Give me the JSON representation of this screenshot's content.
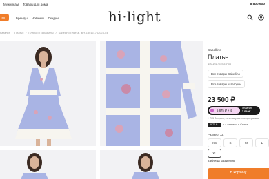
{
  "topbar": {
    "nav": [
      "Мужчинам",
      "Товары для дома"
    ],
    "phone": "8 800 600"
  },
  "logo": "hi·light",
  "header": {
    "catalog_label": "лог",
    "nav": [
      "Бренды",
      "Новинки",
      "Скидки"
    ]
  },
  "breadcrumbs": [
    "Каталог",
    "/",
    "Платья",
    "/",
    "Платья и сарафаны",
    "/",
    "Sabellino Платье, арт. 180161762024-54"
  ],
  "product": {
    "brand": "Sabellino",
    "title": "Платье",
    "sku": "180161762024-54",
    "chips": [
      "Все товары Sabellino",
      "Все товары категории"
    ],
    "price": "23 500 ₽",
    "tbank": {
      "installment": "5 875 ₽ × 4",
      "label_line1": "Оплатить",
      "label_line2": "Т-БАНК"
    },
    "bonus_text": "+ 705 бонусов, если вы участник программы",
    "split": {
      "badge": "5875 ₽",
      "text": "× 4 платежа в Сплит"
    },
    "size_label": "Размер: XL",
    "sizes": [
      "XS",
      "S",
      "M",
      "L",
      "XL"
    ],
    "selected_size": "XL",
    "size_table": "Таблица размеров",
    "cart_button": "В корзину"
  },
  "colors": {
    "accent": "#f07d2a",
    "dress_blue": "#a9b4e4",
    "lace": "#f7f5ef"
  }
}
